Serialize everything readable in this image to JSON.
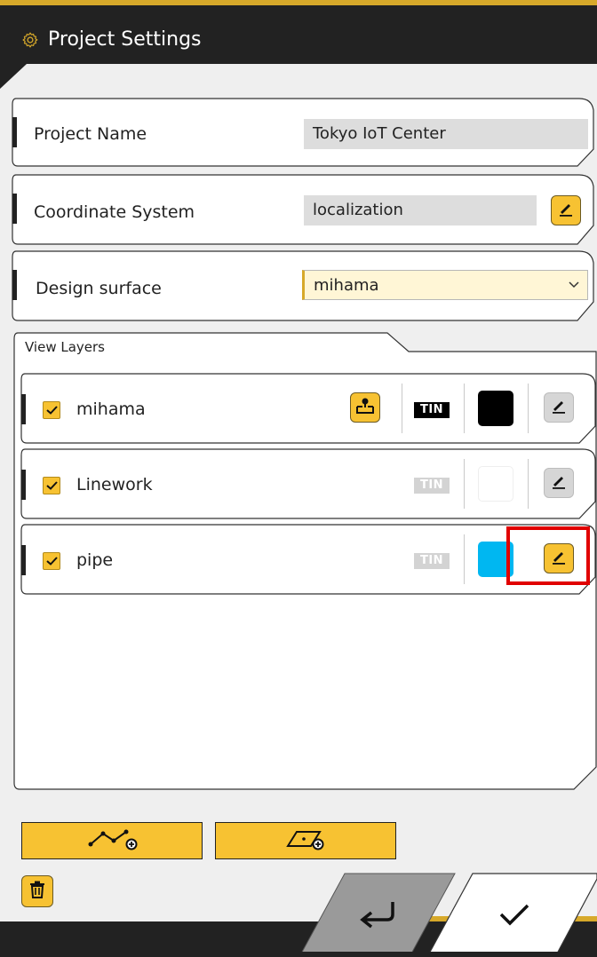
{
  "header": {
    "title": "Project Settings",
    "icon": "gear-icon"
  },
  "fields": {
    "project_name": {
      "label": "Project Name",
      "value": "Tokyo IoT Center"
    },
    "coordinate_system": {
      "label": "Coordinate System",
      "value": "localization"
    },
    "design_surface": {
      "label": "Design surface",
      "value": "mihama"
    }
  },
  "view_layers": {
    "title": "View Layers",
    "items": [
      {
        "name": "mihama",
        "checked": true,
        "tin": "TIN",
        "tin_active": true,
        "color": "#000000",
        "has_geo_button": true
      },
      {
        "name": "Linework",
        "checked": true,
        "tin": "TIN",
        "tin_active": false,
        "color": "#ffffff",
        "has_geo_button": false
      },
      {
        "name": "pipe",
        "checked": true,
        "tin": "TIN",
        "tin_active": false,
        "color": "#00b7f1",
        "has_geo_button": false
      }
    ]
  },
  "actions": {
    "add_linework_icon": "add-linework-icon",
    "add_surface_icon": "add-surface-icon",
    "delete_icon": "trash-icon"
  },
  "footer": {
    "back_icon": "return-arrow-icon",
    "confirm_icon": "checkmark-icon"
  },
  "colors": {
    "accent": "#f7c232",
    "header_bg": "#222222",
    "highlight": "#e10000"
  }
}
